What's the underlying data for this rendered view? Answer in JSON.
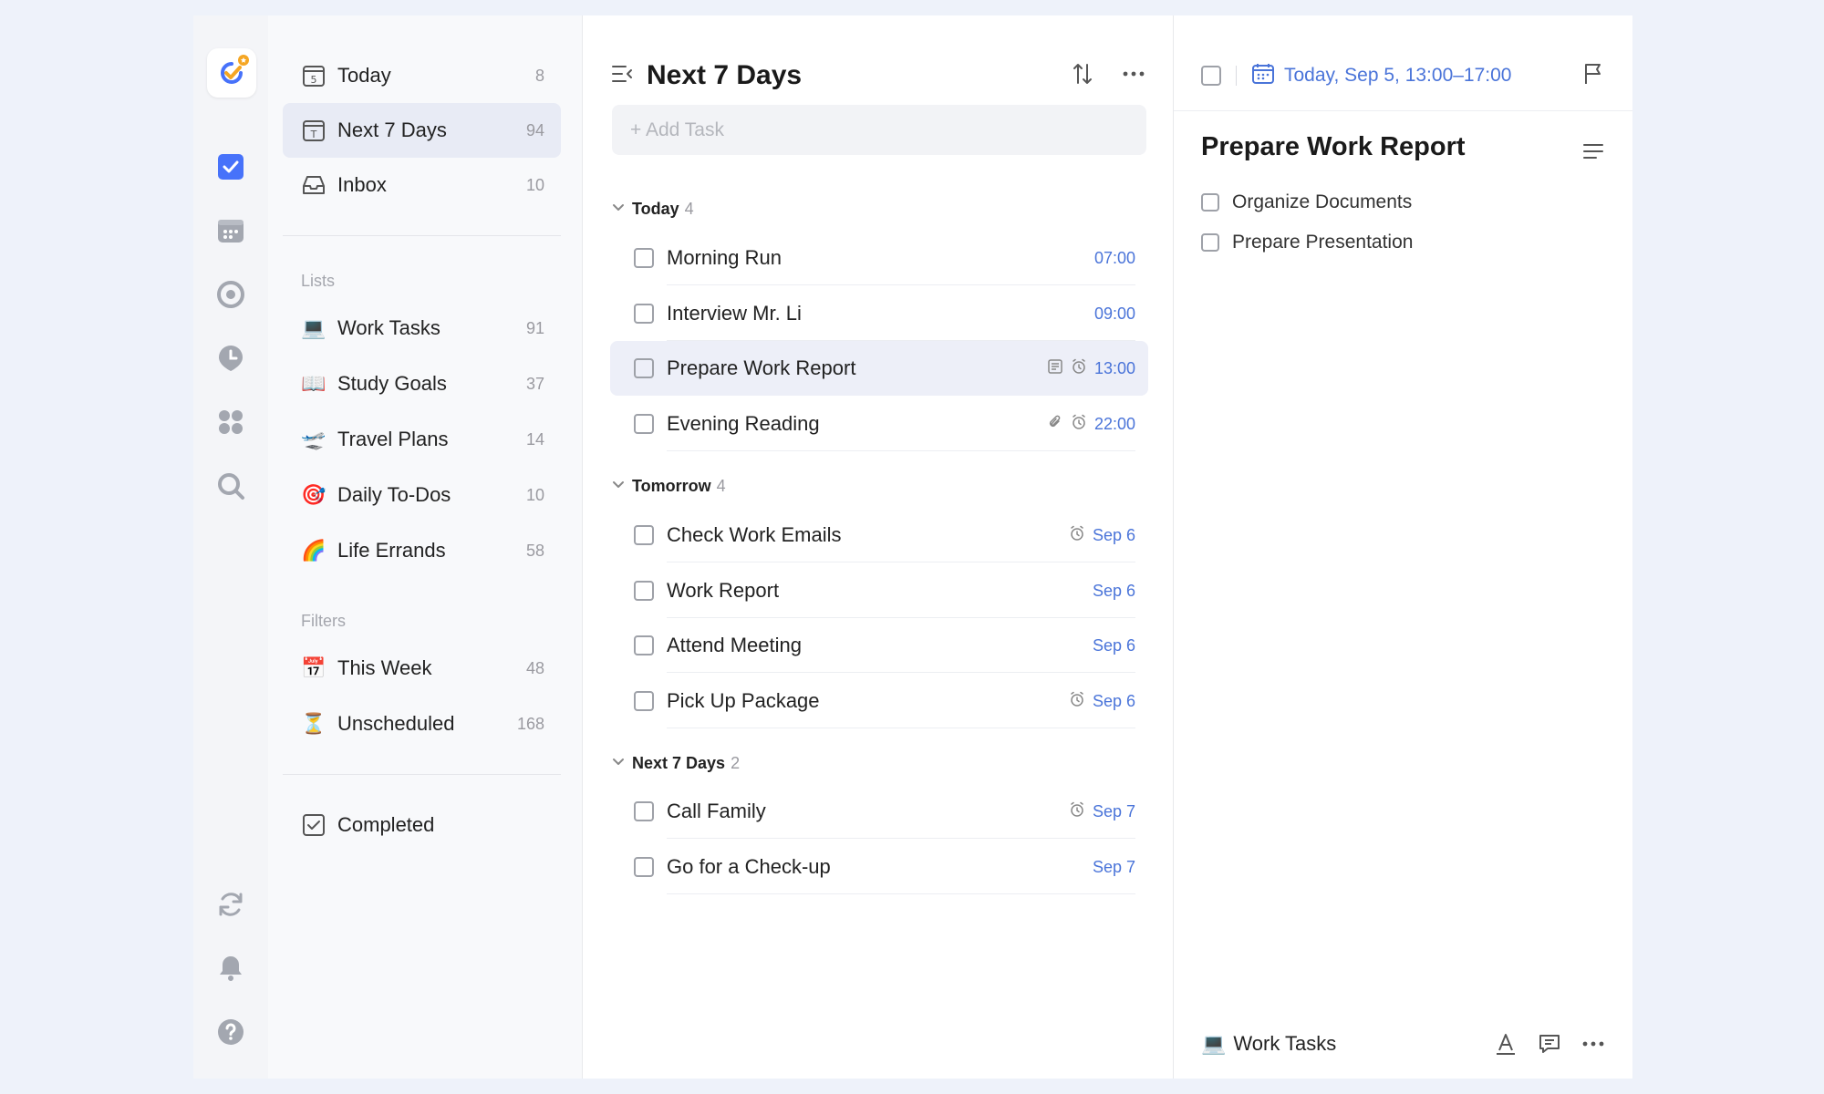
{
  "sidebar": {
    "smart": [
      {
        "label": "Today",
        "count": "8",
        "icon": "calendar-five-icon"
      },
      {
        "label": "Next 7 Days",
        "count": "94",
        "icon": "calendar-t-icon"
      },
      {
        "label": "Inbox",
        "count": "10",
        "icon": "inbox-icon"
      }
    ],
    "lists_title": "Lists",
    "lists": [
      {
        "label": "Work Tasks",
        "count": "91",
        "emoji": "💻"
      },
      {
        "label": "Study Goals",
        "count": "37",
        "emoji": "📖"
      },
      {
        "label": "Travel Plans",
        "count": "14",
        "emoji": "🛫"
      },
      {
        "label": "Daily To-Dos",
        "count": "10",
        "emoji": "🎯"
      },
      {
        "label": "Life Errands",
        "count": "58",
        "emoji": "🌈"
      }
    ],
    "filters_title": "Filters",
    "filters": [
      {
        "label": "This Week",
        "count": "48",
        "emoji": "📅"
      },
      {
        "label": "Unscheduled",
        "count": "168",
        "emoji": "⏳"
      }
    ],
    "completed": "Completed"
  },
  "main": {
    "title": "Next 7 Days",
    "add_placeholder": "+ Add Task",
    "groups": [
      {
        "label": "Today",
        "count": "4"
      },
      {
        "label": "Tomorrow",
        "count": "4"
      },
      {
        "label": "Next 7 Days",
        "count": "2"
      }
    ],
    "tasks": [
      {
        "name": "Morning Run",
        "time": "07:00"
      },
      {
        "name": "Interview Mr. Li",
        "time": "09:00"
      },
      {
        "name": "Prepare Work Report",
        "time": "13:00"
      },
      {
        "name": "Evening Reading",
        "time": "22:00"
      },
      {
        "name": "Check Work Emails",
        "time": "Sep 6"
      },
      {
        "name": "Work Report",
        "time": "Sep 6"
      },
      {
        "name": "Attend Meeting",
        "time": "Sep 6"
      },
      {
        "name": "Pick Up Package",
        "time": "Sep 6"
      },
      {
        "name": "Call Family",
        "time": "Sep 7"
      },
      {
        "name": "Go for a Check-up",
        "time": "Sep 7"
      }
    ]
  },
  "detail": {
    "date": "Today, Sep 5, 13:00–17:00",
    "title": "Prepare Work Report",
    "subtasks": [
      "Organize Documents",
      "Prepare Presentation"
    ],
    "list_emoji": "💻",
    "list_name": "Work Tasks"
  },
  "colors": {
    "accent": "#4a74d9",
    "brand_blue": "#4772fa",
    "brand_badge": "#f5a623"
  }
}
